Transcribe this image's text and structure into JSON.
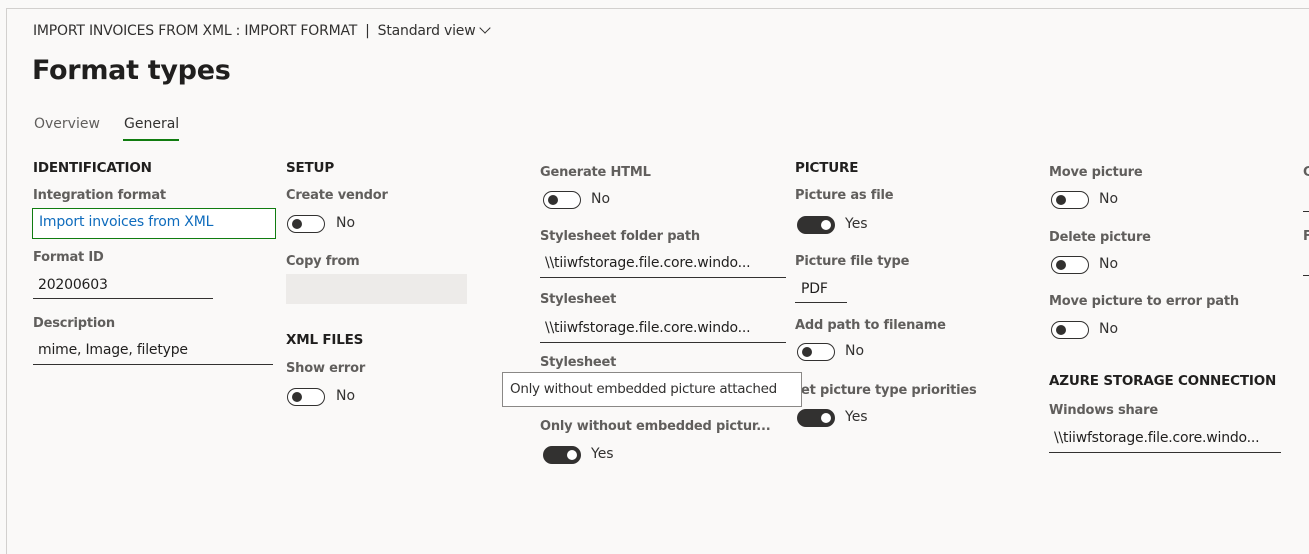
{
  "header": {
    "breadcrumb": "IMPORT INVOICES FROM XML : IMPORT FORMAT",
    "separator": "|",
    "view": "Standard view",
    "title": "Format types"
  },
  "tabs": [
    {
      "label": "Overview",
      "active": false
    },
    {
      "label": "General",
      "active": true
    }
  ],
  "identification": {
    "section": "IDENTIFICATION",
    "integration_format_label": "Integration format",
    "integration_format_value": "Import invoices from XML",
    "format_id_label": "Format ID",
    "format_id_value": "20200603",
    "description_label": "Description",
    "description_value": "mime, Image, filetype"
  },
  "setup": {
    "section": "SETUP",
    "create_vendor_label": "Create vendor",
    "create_vendor_value": "No",
    "copy_from_label": "Copy from",
    "copy_from_value": ""
  },
  "xml_files": {
    "section": "XML FILES",
    "show_error_label": "Show error",
    "show_error_value": "No"
  },
  "html": {
    "generate_html_label": "Generate HTML",
    "generate_html_value": "No",
    "stylesheet_folder_path_label": "Stylesheet folder path",
    "stylesheet_folder_path_value": "\\\\tiiwfstorage.file.core.windo...",
    "stylesheet_label": "Stylesheet",
    "stylesheet_value": "\\\\tiiwfstorage.file.core.windo...",
    "stylesheet2_label": "Stylesheet",
    "only_without_label": "Only without embedded pictur...",
    "only_without_value": "Yes",
    "tooltip": "Only without embedded picture attached"
  },
  "picture": {
    "section": "PICTURE",
    "picture_as_file_label": "Picture as file",
    "picture_as_file_value": "Yes",
    "picture_file_type_label": "Picture file type",
    "picture_file_type_value": "PDF",
    "add_path_label": "Add path to filename",
    "add_path_value": "No",
    "priorities_label": "et picture type priorities",
    "priorities_value": "Yes"
  },
  "move": {
    "move_picture_label": "Move picture",
    "move_picture_value": "No",
    "delete_picture_label": "Delete picture",
    "delete_picture_value": "No",
    "move_error_label": "Move picture to error path",
    "move_error_value": "No"
  },
  "azure": {
    "section": "AZURE STORAGE CONNECTION",
    "windows_share_label": "Windows share",
    "windows_share_value": "\\\\tiiwfstorage.file.core.windo..."
  },
  "cutoff": {
    "c": "C",
    "f": "F"
  },
  "colors": {
    "accent_green": "#107c10",
    "link_blue": "#0f6cbd"
  }
}
